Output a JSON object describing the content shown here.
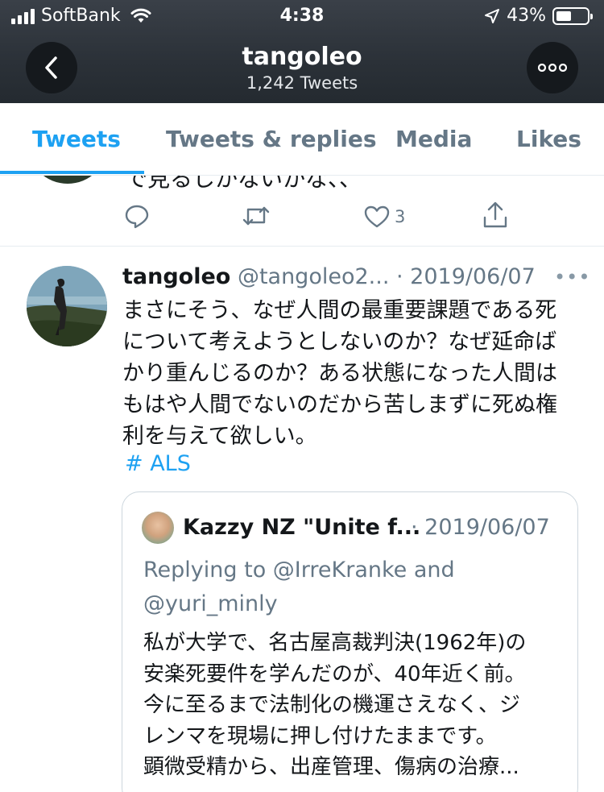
{
  "status_bar": {
    "carrier": "SoftBank",
    "time": "4:38",
    "battery_percent": "43%",
    "battery_level": 0.43
  },
  "header": {
    "title": "tangoleo",
    "subtitle": "1,242 Tweets"
  },
  "tabs": [
    {
      "label": "Tweets",
      "active": true
    },
    {
      "label": "Tweets & replies",
      "active": false
    },
    {
      "label": "Media",
      "active": false
    },
    {
      "label": "Likes",
      "active": false
    }
  ],
  "prev_tweet": {
    "tail_text": "で見るしかないかな、、",
    "like_count": "3"
  },
  "tweet": {
    "name": "tangoleo",
    "handle": "@tangoleo2...",
    "date": "· 2019/06/07",
    "more": "•••",
    "lines": [
      "まさにそう、なぜ人間の最重要課題である死",
      "について考えようとしないのか？なぜ延命ば",
      "かり重んじるのか？ある状態になった人間は",
      "もはや人間でないのだから苦しまずに死ぬ権",
      "利を与えて欲しい。"
    ],
    "hashtag": "# ALS"
  },
  "quote": {
    "name": "Kazzy NZ \"Unite f...",
    "date": "· 2019/06/07",
    "replying_lines": [
      "Replying to @IrreKranke and",
      "@yuri_minly"
    ],
    "lines": [
      "私が大学で、名古屋高裁判決(1962年)の",
      "安楽死要件を学んだのが、40年近く前。",
      "今に至るまで法制化の機運さえなく、ジ",
      "レンマを現場に押し付けたままです。",
      "顕微受精から、出産管理、傷病の治療..."
    ]
  },
  "colors": {
    "accent": "#1da1f2",
    "secondary_text": "#657786",
    "header_bg": "#2c3239",
    "divider": "#e6ecf0"
  },
  "icons": {
    "back": "chevron-left-icon",
    "more": "more-horizontal-icon",
    "reply": "reply-icon",
    "retweet": "retweet-icon",
    "like": "heart-icon",
    "share": "share-icon"
  }
}
